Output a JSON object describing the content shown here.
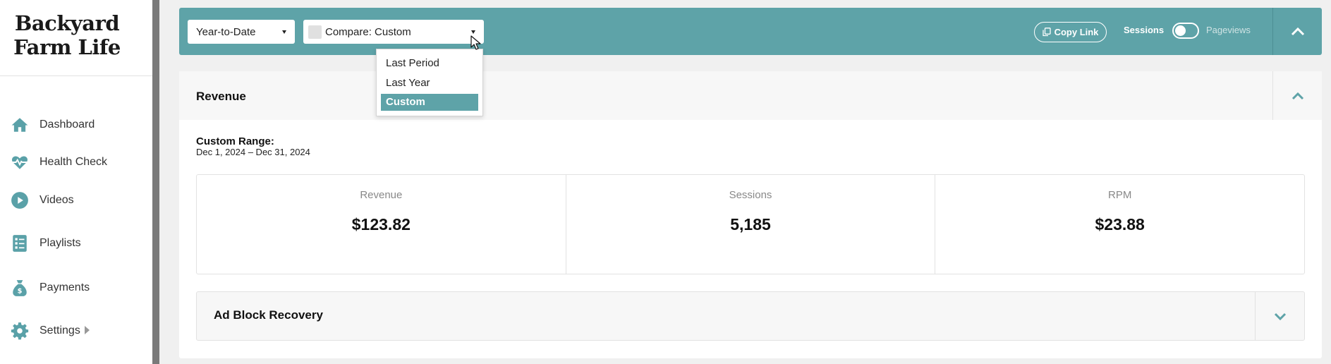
{
  "sidebar": {
    "logo_line1": "Backyard",
    "logo_line2": "Farm Life",
    "items": [
      {
        "label": "Dashboard",
        "icon": "home-icon"
      },
      {
        "label": "Health Check",
        "icon": "heartbeat-icon"
      },
      {
        "label": "Videos",
        "icon": "play-circle-icon"
      },
      {
        "label": "Playlists",
        "icon": "list-icon"
      },
      {
        "label": "Payments",
        "icon": "money-bag-icon"
      },
      {
        "label": "Settings",
        "icon": "gear-icon"
      }
    ]
  },
  "topbar": {
    "period_select": "Year-to-Date",
    "compare_select": "Compare: Custom",
    "copy_link": "Copy Link",
    "toggle_left": "Sessions",
    "toggle_right": "Pageviews"
  },
  "dropdown": {
    "options": [
      "Last Period",
      "Last Year",
      "Custom"
    ],
    "selected": "Custom"
  },
  "revenue_card": {
    "title": "Revenue",
    "range_label": "Custom Range:",
    "range_value": "Dec 1, 2024 – Dec 31, 2024",
    "metrics": [
      {
        "label": "Revenue",
        "value": "$123.82"
      },
      {
        "label": "Sessions",
        "value": "5,185"
      },
      {
        "label": "RPM",
        "value": "$23.88"
      }
    ]
  },
  "adblock": {
    "title": "Ad Block Recovery"
  },
  "colors": {
    "accent": "#5ea3a8",
    "icon": "#5aa1a8"
  }
}
